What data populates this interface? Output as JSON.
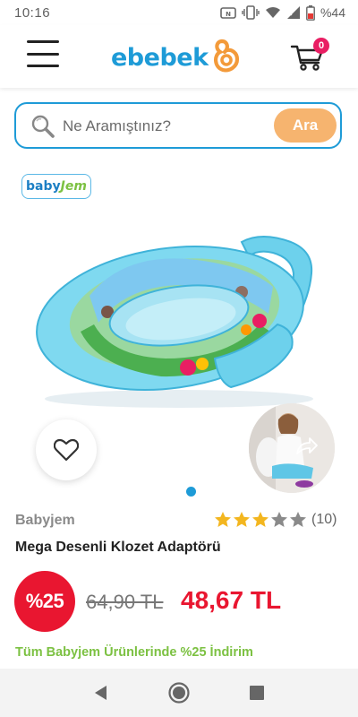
{
  "status_bar": {
    "time": "10:16",
    "battery_text": "%44",
    "icons": [
      "nfc-icon",
      "vibrate-icon",
      "wifi-icon",
      "signal-icon",
      "battery-icon"
    ]
  },
  "header": {
    "logo_text": "ebebek",
    "cart_count": "0",
    "icons": [
      "menu-icon",
      "logo-mark-icon",
      "cart-icon"
    ]
  },
  "search": {
    "placeholder": "Ne Aramıştınız?",
    "value": "",
    "button_label": "Ara"
  },
  "product": {
    "brand_logo": {
      "part1": "baby",
      "part2": "Jem"
    },
    "brand_name": "Babyjem",
    "rating": {
      "filled_stars": 3,
      "total_stars": 5,
      "count_text": "(10)"
    },
    "title": "Mega Desenli Klozet Adaptörü",
    "discount_badge": "%25",
    "old_price": "64,90 TL",
    "new_price": "48,67 TL",
    "campaign_text": "Tüm Babyjem Ürünlerinde %25 İndirim",
    "gallery": {
      "current_index": 1,
      "total_dots": 1
    }
  },
  "colors": {
    "brand_blue": "#1e9bd7",
    "accent_orange": "#f6b46f",
    "sale_red": "#e91630",
    "campaign_green": "#7cc142",
    "star_gold": "#f3b61f",
    "badge_pink": "#e91e63"
  }
}
